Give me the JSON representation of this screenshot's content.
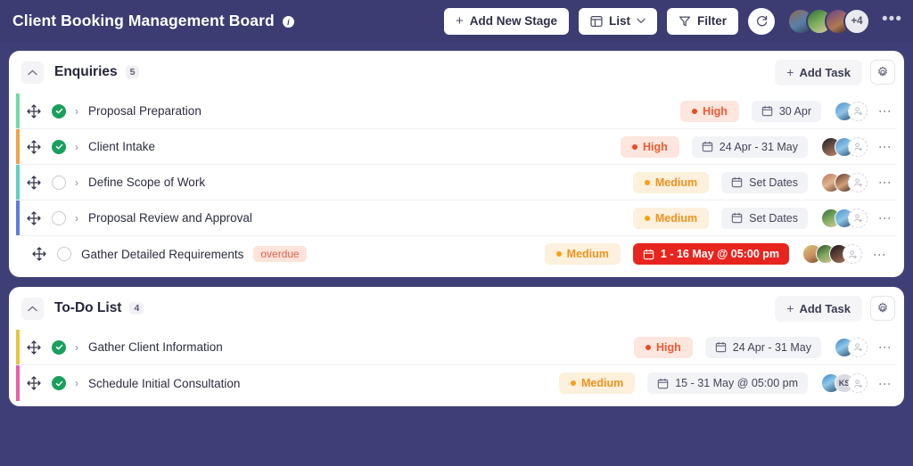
{
  "header": {
    "title": "Client Booking Management Board",
    "info_icon": "info-icon",
    "add_stage_label": "Add New Stage",
    "view_label": "List",
    "filter_label": "Filter",
    "refresh_icon": "refresh-icon",
    "avatar_overflow": "+4",
    "overflow_menu": "•••",
    "colors": {
      "bar_background": "#3c3c72",
      "button_background": "#ffffff"
    }
  },
  "board": {
    "stages": [
      {
        "name": "Enquiries",
        "count": "5",
        "add_task_label": "Add Task",
        "settings_icon": "gear-icon",
        "tasks": [
          {
            "name": "Proposal Preparation",
            "accent": "#6fdba4",
            "status": "done",
            "has_chevron": true,
            "badge": "",
            "priority": "High",
            "priority_level": "high",
            "date": "30 Apr",
            "date_state": "normal",
            "avatars": [
              "p4"
            ],
            "add_person": "add-person-icon"
          },
          {
            "name": "Client Intake",
            "accent": "#f0a447",
            "status": "done",
            "has_chevron": true,
            "badge": "",
            "priority": "High",
            "priority_level": "high",
            "date": "24 Apr - 31 May",
            "date_state": "normal",
            "avatars": [
              "p5",
              "p4"
            ],
            "add_person": "add-person-icon"
          },
          {
            "name": "Define Scope of Work",
            "accent": "#5fd2c2",
            "status": "open",
            "has_chevron": true,
            "badge": "",
            "priority": "Medium",
            "priority_level": "medium",
            "date": "Set Dates",
            "date_state": "normal",
            "avatars": [
              "p6",
              "p7"
            ],
            "add_person": "add-person-icon"
          },
          {
            "name": "Proposal Review and Approval",
            "accent": "#5b7ce0",
            "status": "open",
            "has_chevron": true,
            "badge": "",
            "priority": "Medium",
            "priority_level": "medium",
            "date": "Set Dates",
            "date_state": "normal",
            "avatars": [
              "p2",
              "p4"
            ],
            "add_person": "add-person-icon"
          },
          {
            "name": "Gather Detailed Requirements",
            "accent": "#5b7ce0",
            "status": "open",
            "has_chevron": false,
            "badge": "overdue",
            "priority": "Medium",
            "priority_level": "medium",
            "date": "1 - 16 May @ 05:00 pm",
            "date_state": "overdue",
            "avatars": [
              "p9",
              "p8",
              "p11"
            ],
            "add_person": "add-person-icon"
          }
        ]
      },
      {
        "name": "To-Do List",
        "count": "4",
        "add_task_label": "Add Task",
        "settings_icon": "gear-icon",
        "tasks": [
          {
            "name": "Gather Client Information",
            "accent": "#e8c33c",
            "status": "done",
            "has_chevron": true,
            "badge": "",
            "priority": "High",
            "priority_level": "high",
            "date": "24 Apr - 31 May",
            "date_state": "normal",
            "avatars": [
              "p12"
            ],
            "add_person": "add-person-icon"
          },
          {
            "name": "Schedule Initial Consultation",
            "accent": "#e95fa8",
            "status": "done",
            "has_chevron": true,
            "badge": "",
            "priority": "Medium",
            "priority_level": "medium",
            "date": "15 - 31 May @ 05:00 pm",
            "date_state": "normal",
            "avatars": [
              "p12"
            ],
            "initials_avatar": "KS",
            "add_person": "add-person-icon"
          }
        ]
      }
    ]
  }
}
